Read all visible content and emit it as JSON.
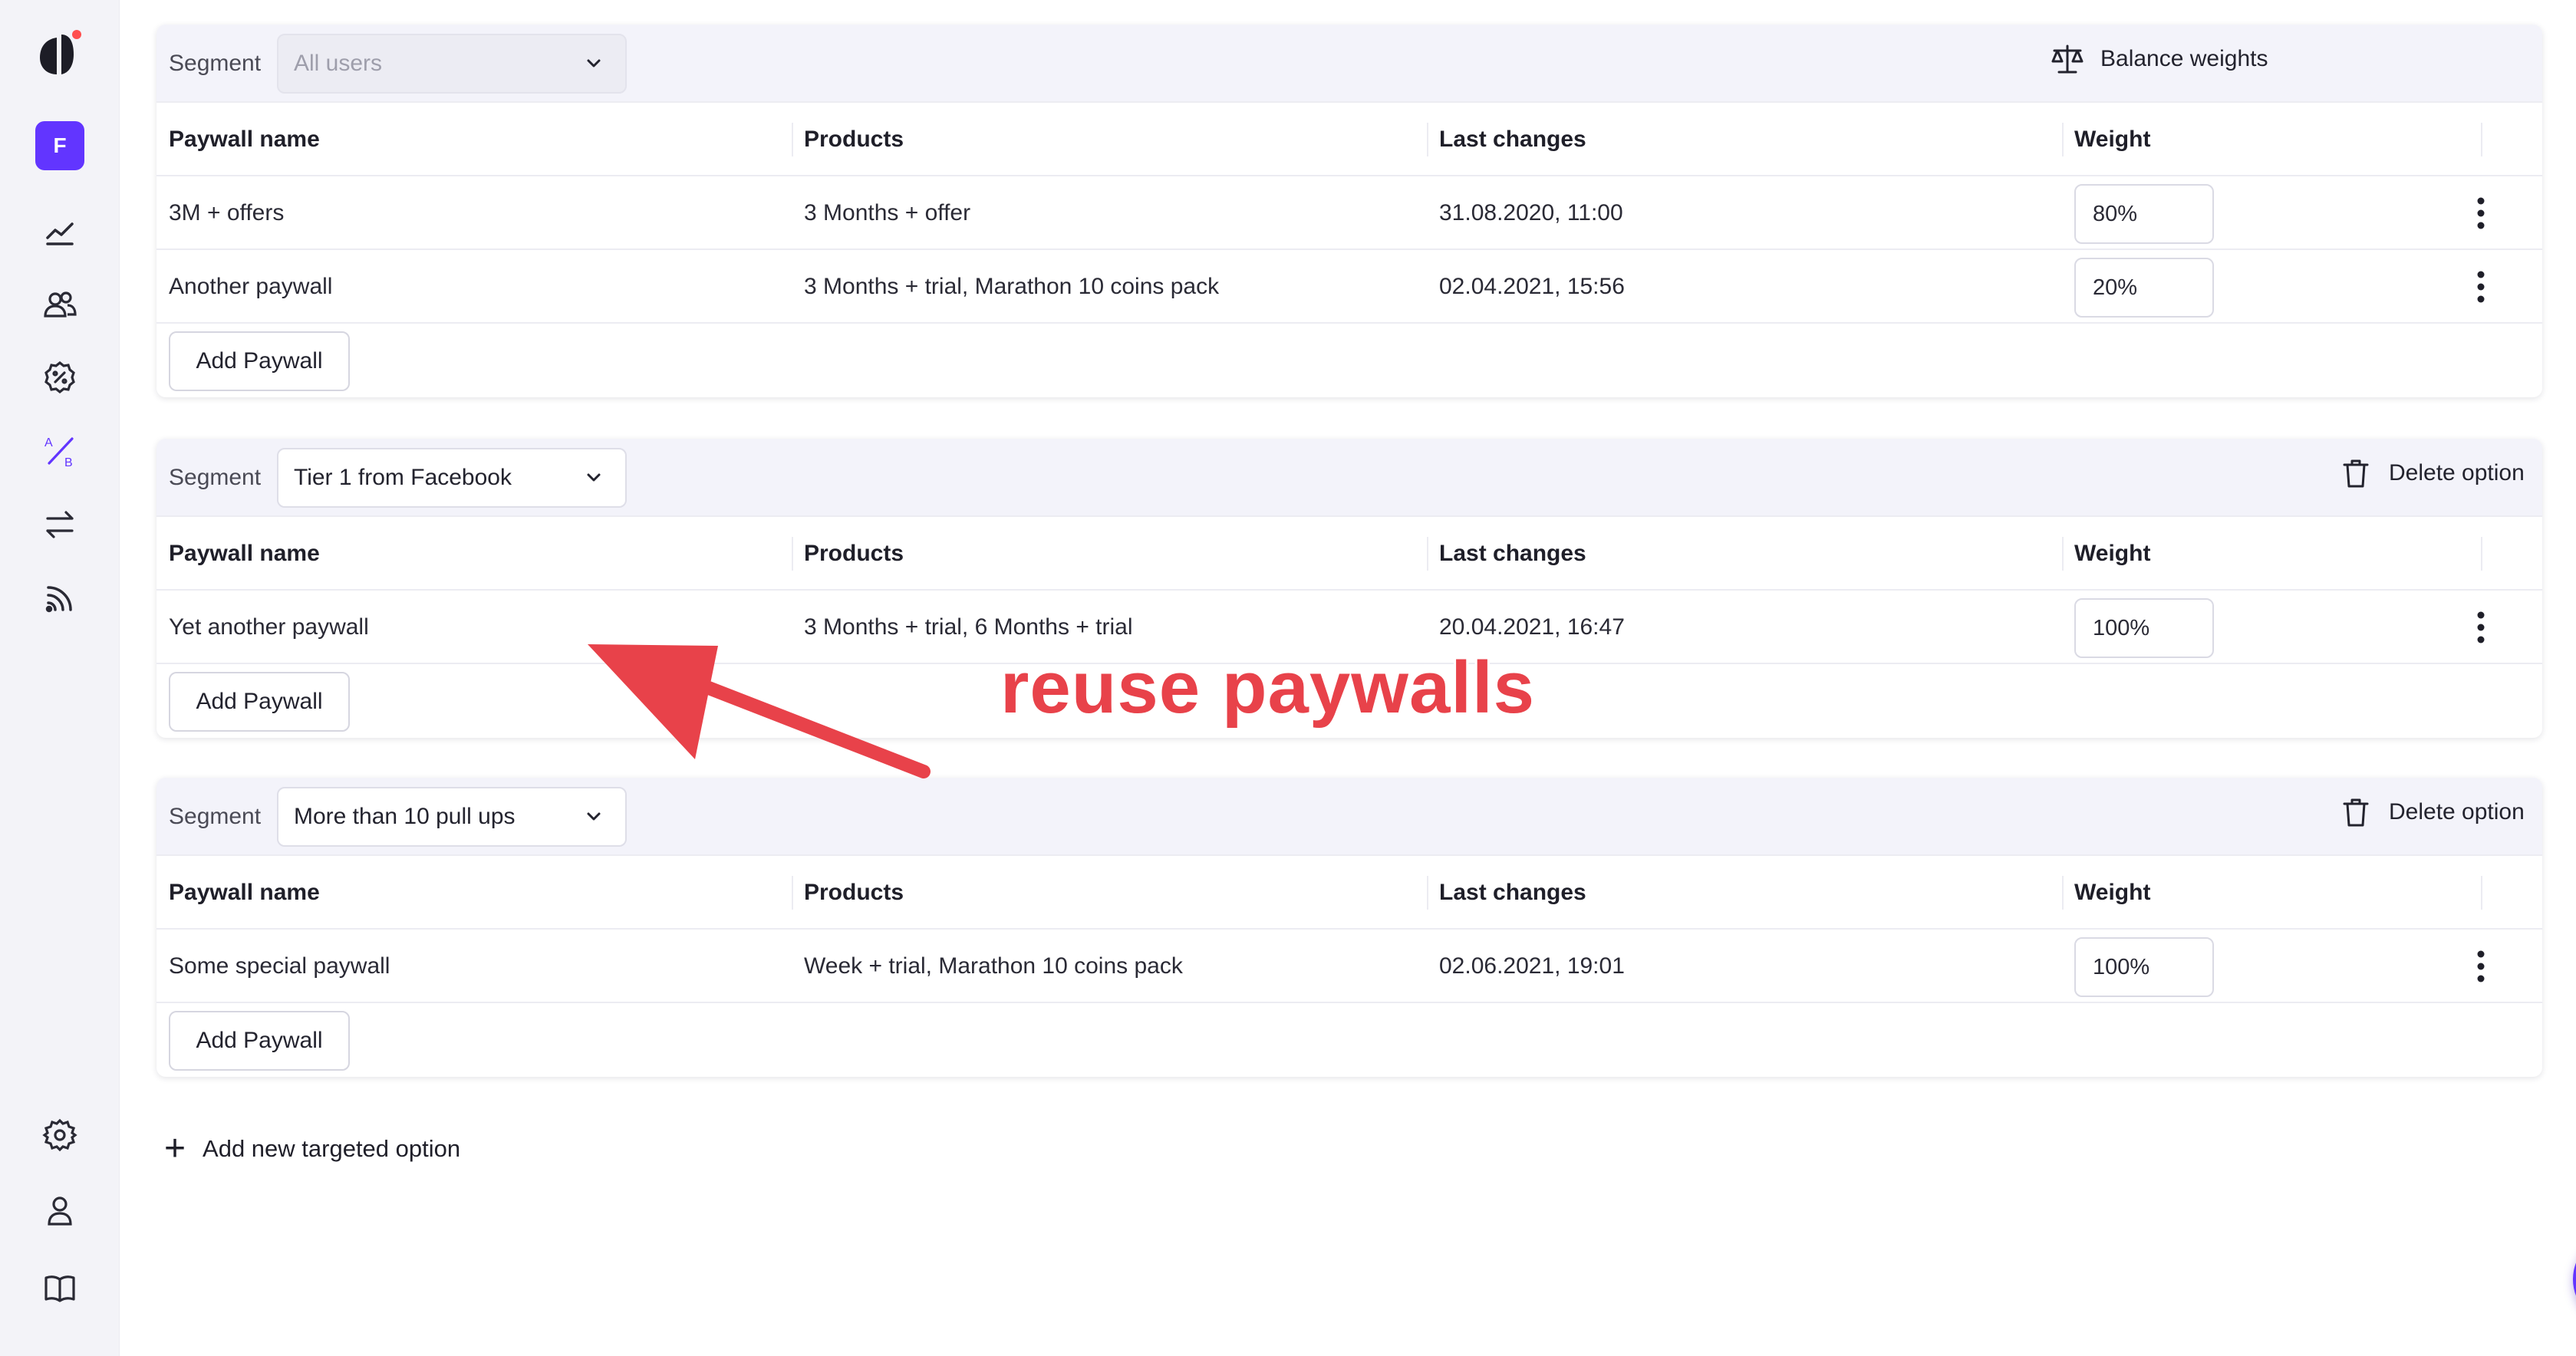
{
  "sidebar": {
    "avatar_letter": "F",
    "ab_top": "A",
    "ab_bottom": "B",
    "icons": [
      "logo-icon",
      "analytics-icon",
      "audience-icon",
      "promo-icon",
      "ab-test-icon",
      "transfer-icon",
      "feed-icon",
      "settings-icon",
      "profile-icon",
      "docs-icon"
    ]
  },
  "segments": [
    {
      "segment_label": "Segment",
      "segment_value": "All users",
      "action_label": "Balance weights",
      "columns": [
        "Paywall name",
        "Products",
        "Last changes",
        "Weight"
      ],
      "rows": [
        {
          "name": "3M + offers",
          "products": "3 Months + offer",
          "last_changes": "31.08.2020, 11:00",
          "weight": "80%"
        },
        {
          "name": "Another paywall",
          "products": "3 Months + trial, Marathon 10 coins pack",
          "last_changes": "02.04.2021, 15:56",
          "weight": "20%"
        }
      ],
      "add_label": "Add Paywall"
    },
    {
      "segment_label": "Segment",
      "segment_value": "Tier 1 from Facebook",
      "action_label": "Delete option",
      "columns": [
        "Paywall name",
        "Products",
        "Last changes",
        "Weight"
      ],
      "rows": [
        {
          "name": "Yet another paywall",
          "products": "3 Months + trial, 6 Months + trial",
          "last_changes": "20.04.2021, 16:47",
          "weight": "100%"
        }
      ],
      "add_label": "Add Paywall"
    },
    {
      "segment_label": "Segment",
      "segment_value": "More than 10 pull ups",
      "action_label": "Delete option",
      "columns": [
        "Paywall name",
        "Products",
        "Last changes",
        "Weight"
      ],
      "rows": [
        {
          "name": "Some special paywall",
          "products": "Week + trial, Marathon 10 coins pack",
          "last_changes": "02.06.2021, 19:01",
          "weight": "100%"
        }
      ],
      "add_label": "Add Paywall"
    }
  ],
  "add_targeted_label": "Add new targeted option",
  "annotation_text": "reuse paywalls",
  "colors": {
    "accent": "#6235ff",
    "annotation": "#e8424a"
  }
}
